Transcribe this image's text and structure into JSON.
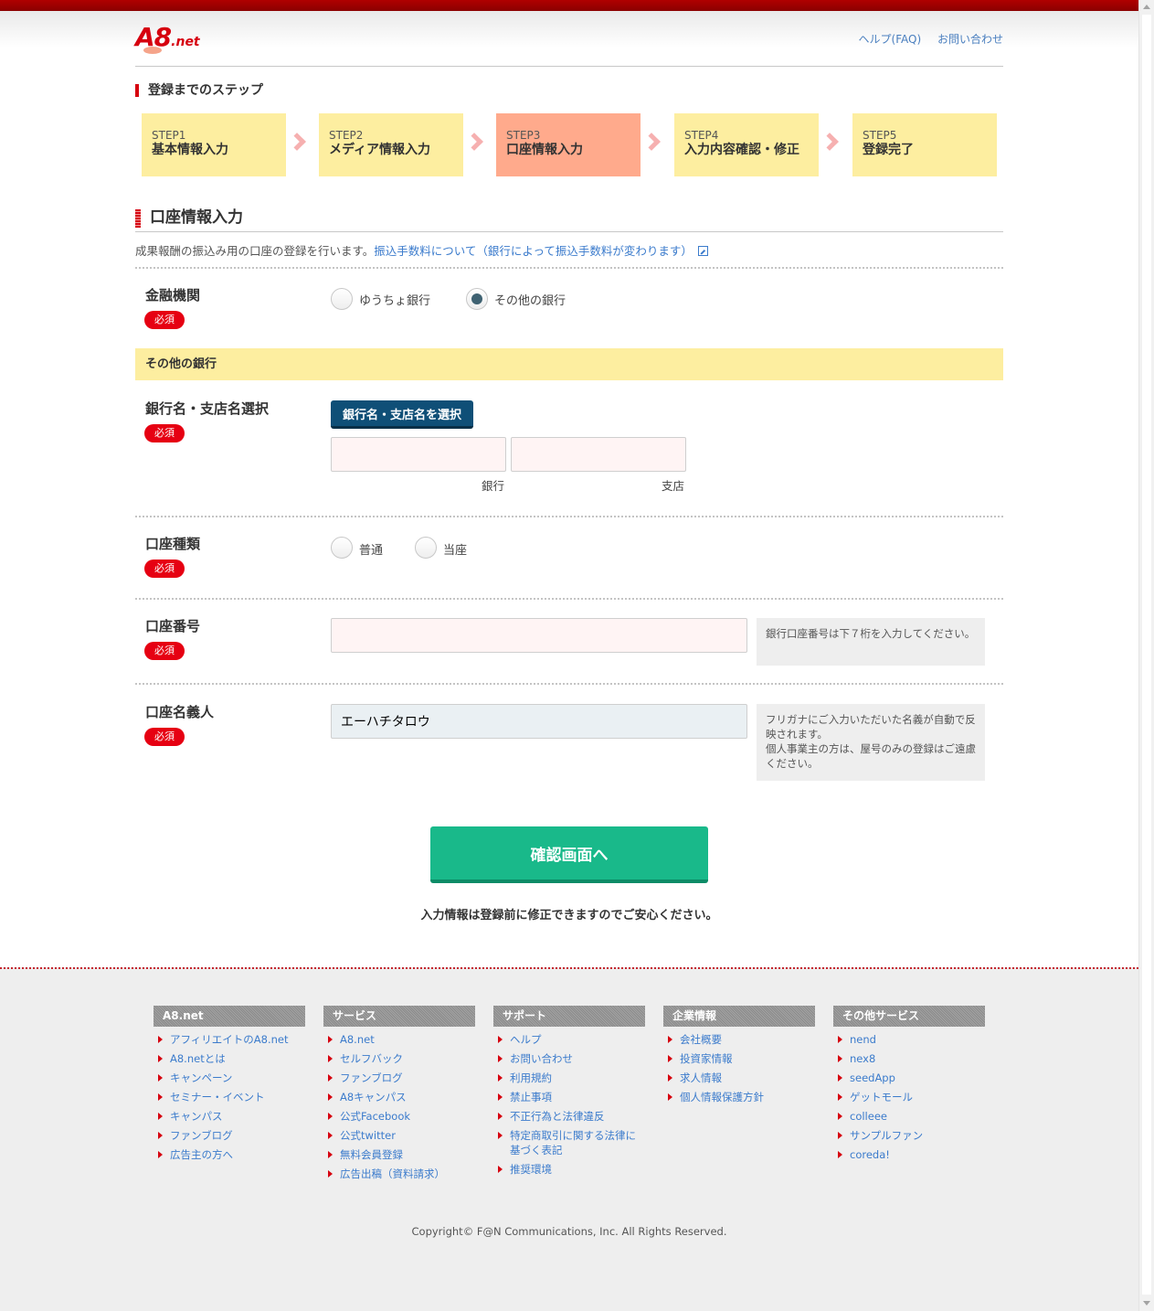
{
  "header": {
    "logo_main": "A8",
    "logo_suffix": ".net",
    "links": [
      "ヘルプ(FAQ)",
      "お問い合わせ"
    ]
  },
  "steps": {
    "title": "登録までのステップ",
    "items": [
      {
        "num": "STEP1",
        "label": "基本情報入力"
      },
      {
        "num": "STEP2",
        "label": "メディア情報入力"
      },
      {
        "num": "STEP3",
        "label": "口座情報入力"
      },
      {
        "num": "STEP4",
        "label": "入力内容確認・修正"
      },
      {
        "num": "STEP5",
        "label": "登録完了"
      }
    ],
    "active_index": 2
  },
  "section": {
    "title": "口座情報入力",
    "intro_text": "成果報酬の振込み用の口座の登録を行います。",
    "intro_link": "振込手数料について（銀行によって振込手数料が変わります）"
  },
  "required_label": "必須",
  "form": {
    "institution": {
      "label": "金融機関",
      "options": [
        "ゆうちょ銀行",
        "その他の銀行"
      ],
      "selected": "その他の銀行"
    },
    "other_bank_heading": "その他の銀行",
    "bank_branch": {
      "label": "銀行名・支店名選択",
      "button": "銀行名・支店名を選択",
      "bank_caption": "銀行",
      "branch_caption": "支店",
      "bank_value": "",
      "branch_value": ""
    },
    "account_type": {
      "label": "口座種類",
      "options": [
        "普通",
        "当座"
      ],
      "selected": ""
    },
    "account_number": {
      "label": "口座番号",
      "value": "",
      "hint": "銀行口座番号は下７桁を入力してください。"
    },
    "account_holder": {
      "label": "口座名義人",
      "value": "エーハチタロウ",
      "hint": "フリガナにご入力いただいた名義が自動で反映されます。\n個人事業主の方は、屋号のみの登録はご遠慮ください。"
    }
  },
  "submit": {
    "label": "確認画面へ",
    "note": "入力情報は登録前に修正できますのでご安心ください。"
  },
  "footer": {
    "columns": [
      {
        "title": "A8.net",
        "links": [
          "アフィリエイトのA8.net",
          "A8.netとは",
          "キャンペーン",
          "セミナー・イベント",
          "キャンパス",
          "ファンブログ",
          "広告主の方へ"
        ]
      },
      {
        "title": "サービス",
        "links": [
          "A8.net",
          "セルフバック",
          "ファンブログ",
          "A8キャンパス",
          "公式Facebook",
          "公式twitter",
          "無料会員登録",
          "広告出稿（資料請求）"
        ]
      },
      {
        "title": "サポート",
        "links": [
          "ヘルプ",
          "お問い合わせ",
          "利用規約",
          "禁止事項",
          "不正行為と法律違反",
          "特定商取引に関する法律に基づく表記",
          "推奨環境"
        ]
      },
      {
        "title": "企業情報",
        "links": [
          "会社概要",
          "投資家情報",
          "求人情報",
          "個人情報保護方針"
        ]
      },
      {
        "title": "その他サービス",
        "links": [
          "nend",
          "nex8",
          "seedApp",
          "ゲットモール",
          "colleee",
          "サンプルファン",
          "coreda!"
        ]
      }
    ],
    "copyright": "Copyright© F@N Communications, Inc. All Rights Reserved."
  },
  "colors": {
    "brand_red": "#d6000f",
    "step_bg": "#fdeea0",
    "step_active": "#ffaa8c",
    "button_navy": "#0f4f77",
    "submit_green": "#19b98a",
    "link_blue": "#3b7bcc"
  }
}
